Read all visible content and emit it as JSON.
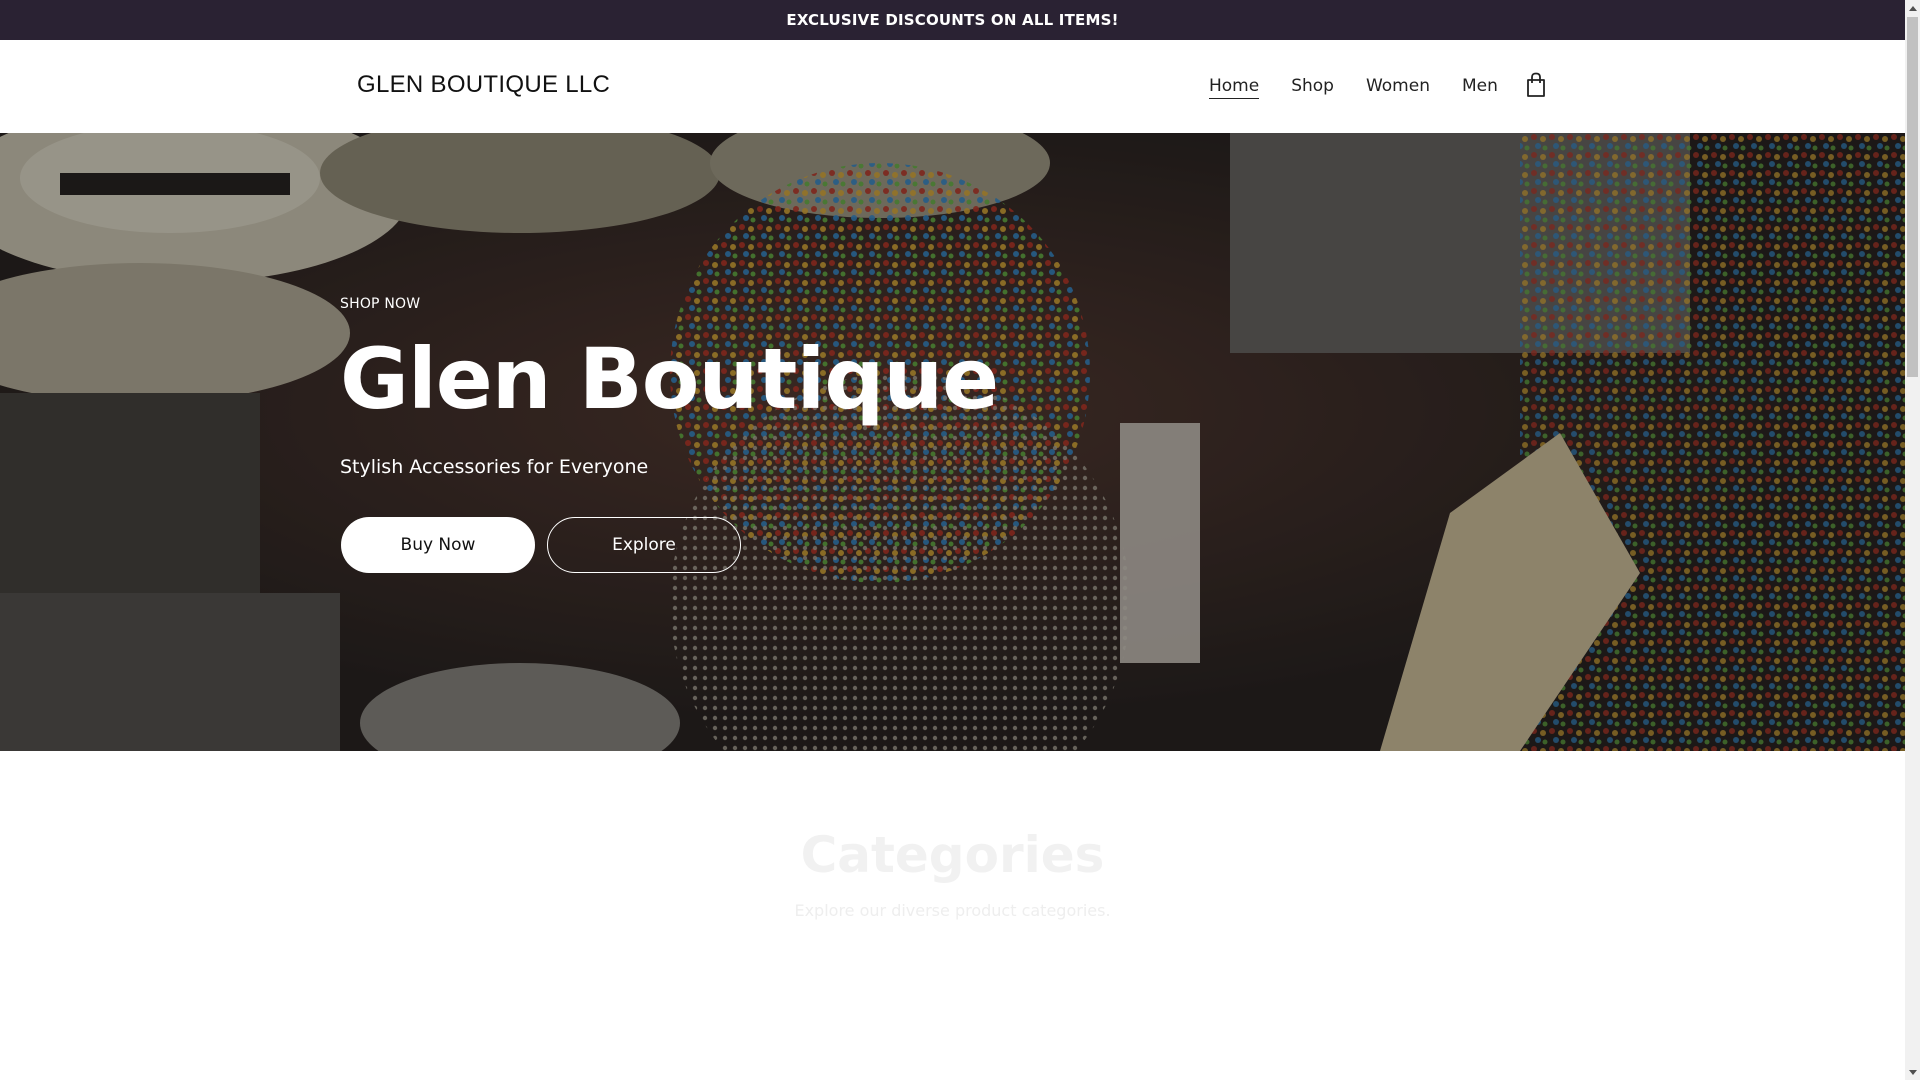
{
  "announcement": {
    "text": "EXCLUSIVE DISCOUNTS ON ALL ITEMS!"
  },
  "header": {
    "logo": "GLEN BOUTIQUE LLC",
    "nav": [
      {
        "label": "Home",
        "active": true
      },
      {
        "label": "Shop",
        "active": false
      },
      {
        "label": "Women",
        "active": false
      },
      {
        "label": "Men",
        "active": false
      }
    ],
    "cart_icon": "shopping-bag-icon"
  },
  "hero": {
    "eyebrow": "SHOP NOW",
    "title": "Glen Boutique",
    "subtitle": "Stylish Accessories for Everyone",
    "primary_button": "Buy Now",
    "secondary_button": "Explore"
  },
  "categories": {
    "title": "Categories",
    "subtitle": "Explore our diverse product categories."
  },
  "colors": {
    "announcement_bg": "#2a2233",
    "text_dark": "#111111",
    "white": "#ffffff"
  }
}
